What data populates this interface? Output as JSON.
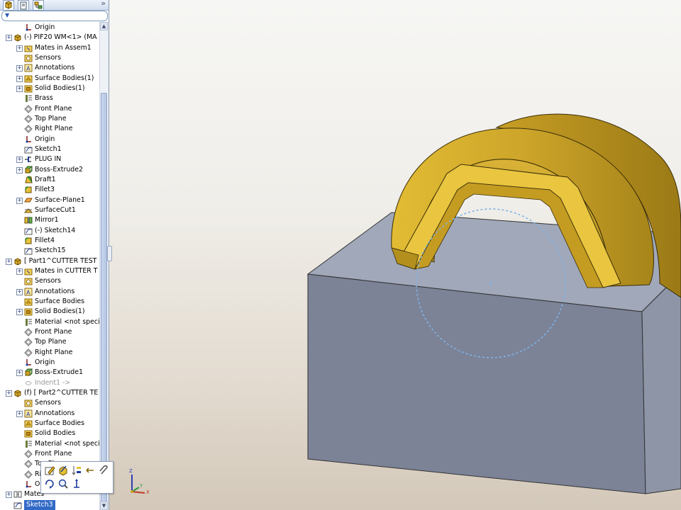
{
  "tree": {
    "tabs": [
      "feature-manager-tab",
      "property-manager-tab",
      "configuration-manager-tab"
    ],
    "items": [
      {
        "label": "Origin",
        "level": 1,
        "icon": "origin-icon",
        "expand": false
      },
      {
        "label": "(-) PIF20 WM<1> (MA",
        "level": 0,
        "icon": "part-icon",
        "expand": true
      },
      {
        "label": "Mates in Assem1",
        "level": 1,
        "icon": "mates-folder-icon",
        "expand": true
      },
      {
        "label": "Sensors",
        "level": 1,
        "icon": "sensors-icon",
        "expand": false
      },
      {
        "label": "Annotations",
        "level": 1,
        "icon": "annotations-icon",
        "expand": true
      },
      {
        "label": "Surface Bodies(1)",
        "level": 1,
        "icon": "surface-bodies-icon",
        "expand": true
      },
      {
        "label": "Solid Bodies(1)",
        "level": 1,
        "icon": "solid-bodies-icon",
        "expand": true
      },
      {
        "label": "Brass",
        "level": 1,
        "icon": "material-icon",
        "expand": false
      },
      {
        "label": "Front Plane",
        "level": 1,
        "icon": "plane-icon",
        "expand": false
      },
      {
        "label": "Top Plane",
        "level": 1,
        "icon": "plane-icon",
        "expand": false
      },
      {
        "label": "Right Plane",
        "level": 1,
        "icon": "plane-icon",
        "expand": false
      },
      {
        "label": "Origin",
        "level": 1,
        "icon": "origin-icon",
        "expand": false
      },
      {
        "label": "Sketch1",
        "level": 1,
        "icon": "sketch-icon",
        "expand": false
      },
      {
        "label": "PLUG IN",
        "level": 1,
        "icon": "plug-icon",
        "expand": true
      },
      {
        "label": "Boss-Extrude2",
        "level": 1,
        "icon": "extrude-icon",
        "expand": true
      },
      {
        "label": "Draft1",
        "level": 1,
        "icon": "draft-icon",
        "expand": false
      },
      {
        "label": "Fillet3",
        "level": 1,
        "icon": "fillet-icon",
        "expand": false
      },
      {
        "label": "Surface-Plane1",
        "level": 1,
        "icon": "surface-plane-icon",
        "expand": true
      },
      {
        "label": "SurfaceCut1",
        "level": 1,
        "icon": "surface-cut-icon",
        "expand": false
      },
      {
        "label": "Mirror1",
        "level": 1,
        "icon": "mirror-icon",
        "expand": false
      },
      {
        "label": "(-) Sketch14",
        "level": 1,
        "icon": "sketch-icon",
        "expand": false
      },
      {
        "label": "Fillet4",
        "level": 1,
        "icon": "fillet-icon",
        "expand": false
      },
      {
        "label": "Sketch15",
        "level": 1,
        "icon": "sketch-icon",
        "expand": false
      },
      {
        "label": "[ Part1^CUTTER TEST",
        "level": 0,
        "icon": "part-icon",
        "expand": true
      },
      {
        "label": "Mates in CUTTER T",
        "level": 1,
        "icon": "mates-folder-icon",
        "expand": true
      },
      {
        "label": "Sensors",
        "level": 1,
        "icon": "sensors-icon",
        "expand": false
      },
      {
        "label": "Annotations",
        "level": 1,
        "icon": "annotations-icon",
        "expand": true
      },
      {
        "label": "Surface Bodies",
        "level": 1,
        "icon": "surface-bodies-icon",
        "expand": false
      },
      {
        "label": "Solid Bodies(1)",
        "level": 1,
        "icon": "solid-bodies-icon",
        "expand": true
      },
      {
        "label": "Material <not speci",
        "level": 1,
        "icon": "material-icon",
        "expand": false
      },
      {
        "label": "Front Plane",
        "level": 1,
        "icon": "plane-icon",
        "expand": false
      },
      {
        "label": "Top Plane",
        "level": 1,
        "icon": "plane-icon",
        "expand": false
      },
      {
        "label": "Right Plane",
        "level": 1,
        "icon": "plane-icon",
        "expand": false
      },
      {
        "label": "Origin",
        "level": 1,
        "icon": "origin-icon",
        "expand": false
      },
      {
        "label": "Boss-Extrude1",
        "level": 1,
        "icon": "extrude-icon",
        "expand": true
      },
      {
        "label": "Indent1 ->",
        "level": 1,
        "icon": "indent-icon",
        "expand": false,
        "dim": true
      },
      {
        "label": "(f) [ Part2^CUTTER TE",
        "level": 0,
        "icon": "part-icon",
        "expand": true
      },
      {
        "label": "Sensors",
        "level": 1,
        "icon": "sensors-icon",
        "expand": false
      },
      {
        "label": "Annotations",
        "level": 1,
        "icon": "annotations-icon",
        "expand": true
      },
      {
        "label": "Surface Bodies",
        "level": 1,
        "icon": "surface-bodies-icon",
        "expand": false
      },
      {
        "label": "Solid Bodies",
        "level": 1,
        "icon": "solid-bodies-icon",
        "expand": false
      },
      {
        "label": "Material <not speci",
        "level": 1,
        "icon": "material-icon",
        "expand": false
      },
      {
        "label": "Front Plane",
        "level": 1,
        "icon": "plane-icon",
        "expand": false
      },
      {
        "label": "Top Plane",
        "level": 1,
        "icon": "plane-icon",
        "expand": false
      },
      {
        "label": "Right Plane",
        "level": 1,
        "icon": "plane-icon",
        "expand": false
      },
      {
        "label": "Origin",
        "level": 1,
        "icon": "origin-icon",
        "expand": false
      },
      {
        "label": "Mates",
        "level": 0,
        "icon": "mates-icon",
        "expand": true
      },
      {
        "label": "Sketch3",
        "level": 0,
        "icon": "sketch-icon",
        "expand": false,
        "selected": true
      }
    ]
  },
  "context_toolbar": {
    "icons": [
      "edit-sketch-icon",
      "edit-part-icon",
      "reorder-icon",
      "rollback-icon",
      "attach-icon",
      "rotate-view-icon",
      "zoom-icon",
      "normal-to-icon"
    ]
  },
  "triad": {
    "x_label": "X",
    "y_label": "Y",
    "z_label": "Z"
  },
  "colors": {
    "part_gold": "#c9a420",
    "block_gray": "#7e8599",
    "sketch_circle": "#7fb3e6",
    "selection": "#3169c6"
  }
}
